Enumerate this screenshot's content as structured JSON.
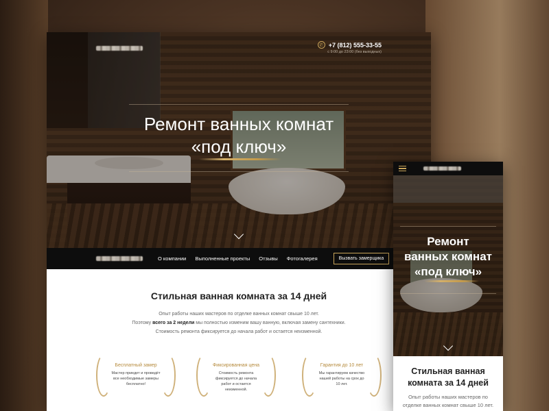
{
  "phone": "+7 (812) 555-33-55",
  "hours": "с 9:00 до 23:00 (без выходных)",
  "hero": {
    "title_line1": "Ремонт ванных комнат",
    "title_line2": "«под ключ»"
  },
  "nav": {
    "items": [
      "О компании",
      "Выполненные проекты",
      "Отзывы",
      "Фотогалерея"
    ],
    "cta": "Вызвать замерщика"
  },
  "intro": {
    "heading": "Стильная ванная комната за 14 дней",
    "line1": "Опыт работы наших мастеров по отделке ванных комнат свыше 10 лет.",
    "line2_before": "Поэтому ",
    "line2_bold": "всего за 2 недели",
    "line2_after": " мы полностью изменим вашу ванную, включая замену сантехники.",
    "line3": "Стоимость ремонта фиксируется до начала работ и остается неизменной."
  },
  "features": [
    {
      "title": "Бесплатный замер",
      "text": "Мастер приедет и проведёт все необходимые замеры бесплатно!"
    },
    {
      "title": "Фиксированная цена",
      "text": "Стоимость ремонта фиксируется до начала работ и остается неизменной."
    },
    {
      "title": "Гарантия до 10 лет",
      "text": "Мы гарантируем качество нашей работы на срок до 10 лет."
    }
  ],
  "mobile": {
    "hero_line1": "Ремонт",
    "hero_line2": "ванных комнат",
    "hero_line3": "«под ключ»",
    "heading_line1": "Стильная ванная",
    "heading_line2": "комната за 14 дней",
    "para_line1": "Опыт работы наших мастеров по",
    "para_line2": "отделке ванных комнат свыше 10 лет."
  },
  "colors": {
    "accent": "#c9a55a",
    "nav_bg": "#0d0d0d",
    "feature_title": "#b58a3c"
  }
}
